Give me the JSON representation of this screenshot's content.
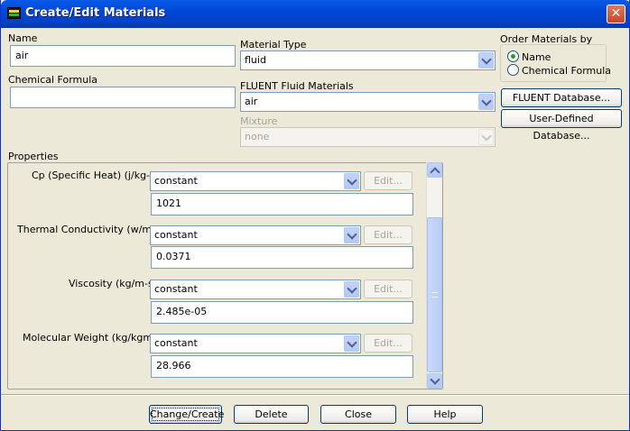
{
  "window": {
    "title": "Create/Edit Materials",
    "close_symbol": "✕"
  },
  "fields": {
    "name_label": "Name",
    "name_value": "air",
    "formula_label": "Chemical Formula",
    "formula_value": "",
    "material_type_label": "Material Type",
    "material_type_value": "fluid",
    "fluent_materials_label": "FLUENT Fluid Materials",
    "fluent_materials_value": "air",
    "mixture_label": "Mixture",
    "mixture_value": "none"
  },
  "order": {
    "label": "Order Materials by",
    "options": [
      {
        "label": "Name",
        "selected": true
      },
      {
        "label": "Chemical Formula",
        "selected": false
      }
    ]
  },
  "databases": {
    "fluent_db": "FLUENT Database...",
    "user_db": "User-Defined Database..."
  },
  "properties": {
    "label": "Properties",
    "items": [
      {
        "name": "Cp (Specific Heat) (j/kg-k)",
        "method": "constant",
        "edit": "Edit...",
        "value": "1021"
      },
      {
        "name": "Thermal Conductivity (w/m-k)",
        "method": "constant",
        "edit": "Edit...",
        "value": "0.0371"
      },
      {
        "name": "Viscosity (kg/m-s)",
        "method": "constant",
        "edit": "Edit...",
        "value": "2.485e-05"
      },
      {
        "name": "Molecular Weight (kg/kgmol)",
        "method": "constant",
        "edit": "Edit...",
        "value": "28.966"
      }
    ]
  },
  "actions": {
    "change_create": "Change/Create",
    "delete": "Delete",
    "close": "Close",
    "help": "Help"
  }
}
